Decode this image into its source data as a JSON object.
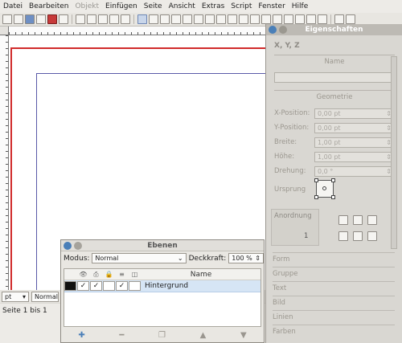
{
  "menu": [
    "Datei",
    "Bearbeiten",
    "Objekt",
    "Einfügen",
    "Seite",
    "Ansicht",
    "Extras",
    "Script",
    "Fenster",
    "Hilfe"
  ],
  "menu_disabled": [
    "Objekt"
  ],
  "status": {
    "unit": "pt",
    "mode": "Normal",
    "page_text": "Seite 1 bis 1"
  },
  "properties": {
    "title": "Eigenschaften",
    "tabs": "X, Y, Z",
    "name_label": "Name",
    "geometrie_label": "Geometrie",
    "fields": [
      {
        "label": "X-Position:",
        "value": "0,00 pt"
      },
      {
        "label": "Y-Position:",
        "value": "0,00 pt"
      },
      {
        "label": "Breite:",
        "value": "1,00 pt"
      },
      {
        "label": "Höhe:",
        "value": "1,00 pt"
      },
      {
        "label": "Drehung:",
        "value": "0,0 °"
      }
    ],
    "ursprung_label": "Ursprung",
    "anordnung_label": "Anordnung",
    "anordnung_value": "1",
    "sections": [
      "Form",
      "Gruppe",
      "Text",
      "Bild",
      "Linien",
      "Farben"
    ]
  },
  "layers": {
    "title": "Ebenen",
    "modus_label": "Modus:",
    "modus_value": "Normal",
    "deckkraft_label": "Deckkraft:",
    "deckkraft_value": "100 %",
    "name_header": "Name",
    "row_name": "Hintergrund",
    "checks": [
      "✓",
      "✓",
      "",
      "✓",
      ""
    ]
  }
}
